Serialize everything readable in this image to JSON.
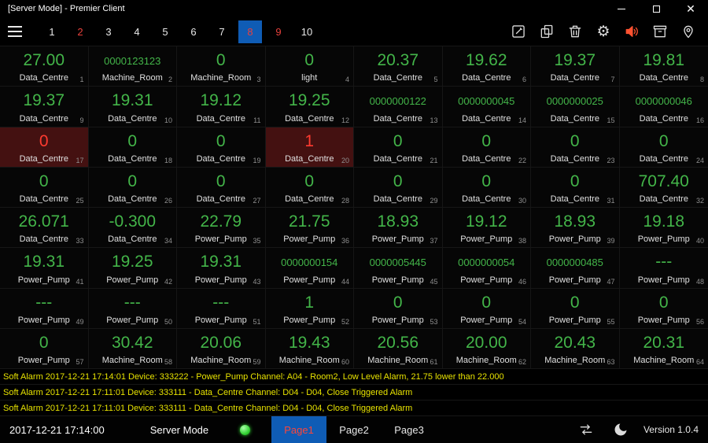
{
  "window": {
    "title": "[Server Mode] - Premier Client"
  },
  "icons": {
    "gear": "⚙",
    "map": {
      "menu": "hamburger",
      "edit": "pencil-square",
      "report": "copy-pages",
      "delete": "trash-bin",
      "settings": "gear",
      "alarm_sound": "speaker-red",
      "clear": "archive-box",
      "location": "map-pin",
      "sync": "swap-arrows",
      "theme": "crescent-moon",
      "mode": "green-dot"
    }
  },
  "colors": {
    "value_green": "#43b549",
    "alarm_red": "#ff3b30",
    "alarm_tile_bg": "#441111",
    "page_blue": "#0f5cb5",
    "alarm_text_yellow": "#e8e300",
    "status_green": "#35d435",
    "speaker_orange": "#ff5230",
    "page_alarm_red": "#e8413c",
    "active_tab_text": "#ff4538"
  },
  "toolbar": {
    "pages": [
      {
        "label": "1",
        "class": ""
      },
      {
        "label": "2",
        "class": "alarm"
      },
      {
        "label": "3",
        "class": ""
      },
      {
        "label": "4",
        "class": ""
      },
      {
        "label": "5",
        "class": ""
      },
      {
        "label": "6",
        "class": ""
      },
      {
        "label": "7",
        "class": ""
      },
      {
        "label": "8",
        "class": "selected alarm"
      },
      {
        "label": "9",
        "class": "alarm"
      },
      {
        "label": "10",
        "class": ""
      }
    ]
  },
  "grid": {
    "tiles": [
      {
        "value": "27.00",
        "label": "Data_Centre",
        "idx": "1",
        "class": ""
      },
      {
        "value": "0000123123",
        "label": "Machine_Room",
        "idx": "2",
        "class": ""
      },
      {
        "value": "0",
        "label": "Machine_Room",
        "idx": "3",
        "class": ""
      },
      {
        "value": "0",
        "label": "light",
        "idx": "4",
        "class": ""
      },
      {
        "value": "20.37",
        "label": "Data_Centre",
        "idx": "5",
        "class": ""
      },
      {
        "value": "19.62",
        "label": "Data_Centre",
        "idx": "6",
        "class": ""
      },
      {
        "value": "19.37",
        "label": "Data_Centre",
        "idx": "7",
        "class": ""
      },
      {
        "value": "19.81",
        "label": "Data_Centre",
        "idx": "8",
        "class": ""
      },
      {
        "value": "19.37",
        "label": "Data_Centre",
        "idx": "9",
        "class": ""
      },
      {
        "value": "19.31",
        "label": "Data_Centre",
        "idx": "10",
        "class": ""
      },
      {
        "value": "19.12",
        "label": "Data_Centre",
        "idx": "11",
        "class": ""
      },
      {
        "value": "19.25",
        "label": "Data_Centre",
        "idx": "12",
        "class": ""
      },
      {
        "value": "0000000122",
        "label": "Data_Centre",
        "idx": "13",
        "class": ""
      },
      {
        "value": "0000000045",
        "label": "Data_Centre",
        "idx": "14",
        "class": ""
      },
      {
        "value": "0000000025",
        "label": "Data_Centre",
        "idx": "15",
        "class": ""
      },
      {
        "value": "0000000046",
        "label": "Data_Centre",
        "idx": "16",
        "class": ""
      },
      {
        "value": "0",
        "label": "Data_Centre",
        "idx": "17",
        "class": "alarm"
      },
      {
        "value": "0",
        "label": "Data_Centre",
        "idx": "18",
        "class": ""
      },
      {
        "value": "0",
        "label": "Data_Centre",
        "idx": "19",
        "class": ""
      },
      {
        "value": "1",
        "label": "Data_Centre",
        "idx": "20",
        "class": "alarm"
      },
      {
        "value": "0",
        "label": "Data_Centre",
        "idx": "21",
        "class": ""
      },
      {
        "value": "0",
        "label": "Data_Centre",
        "idx": "22",
        "class": ""
      },
      {
        "value": "0",
        "label": "Data_Centre",
        "idx": "23",
        "class": ""
      },
      {
        "value": "0",
        "label": "Data_Centre",
        "idx": "24",
        "class": ""
      },
      {
        "value": "0",
        "label": "Data_Centre",
        "idx": "25",
        "class": ""
      },
      {
        "value": "0",
        "label": "Data_Centre",
        "idx": "26",
        "class": ""
      },
      {
        "value": "0",
        "label": "Data_Centre",
        "idx": "27",
        "class": ""
      },
      {
        "value": "0",
        "label": "Data_Centre",
        "idx": "28",
        "class": ""
      },
      {
        "value": "0",
        "label": "Data_Centre",
        "idx": "29",
        "class": ""
      },
      {
        "value": "0",
        "label": "Data_Centre",
        "idx": "30",
        "class": ""
      },
      {
        "value": "0",
        "label": "Data_Centre",
        "idx": "31",
        "class": ""
      },
      {
        "value": "707.40",
        "label": "Data_Centre",
        "idx": "32",
        "class": ""
      },
      {
        "value": "26.071",
        "label": "Data_Centre",
        "idx": "33",
        "class": ""
      },
      {
        "value": "-0.300",
        "label": "Data_Centre",
        "idx": "34",
        "class": ""
      },
      {
        "value": "22.79",
        "label": "Power_Pump",
        "idx": "35",
        "class": ""
      },
      {
        "value": "21.75",
        "label": "Power_Pump",
        "idx": "36",
        "class": ""
      },
      {
        "value": "18.93",
        "label": "Power_Pump",
        "idx": "37",
        "class": ""
      },
      {
        "value": "19.12",
        "label": "Power_Pump",
        "idx": "38",
        "class": ""
      },
      {
        "value": "18.93",
        "label": "Power_Pump",
        "idx": "39",
        "class": ""
      },
      {
        "value": "19.18",
        "label": "Power_Pump",
        "idx": "40",
        "class": ""
      },
      {
        "value": "19.31",
        "label": "Power_Pump",
        "idx": "41",
        "class": ""
      },
      {
        "value": "19.25",
        "label": "Power_Pump",
        "idx": "42",
        "class": ""
      },
      {
        "value": "19.31",
        "label": "Power_Pump",
        "idx": "43",
        "class": ""
      },
      {
        "value": "0000000154",
        "label": "Power_Pump",
        "idx": "44",
        "class": ""
      },
      {
        "value": "0000005445",
        "label": "Power_Pump",
        "idx": "45",
        "class": ""
      },
      {
        "value": "0000000054",
        "label": "Power_Pump",
        "idx": "46",
        "class": ""
      },
      {
        "value": "0000000485",
        "label": "Power_Pump",
        "idx": "47",
        "class": ""
      },
      {
        "value": "---",
        "label": "Power_Pump",
        "idx": "48",
        "class": ""
      },
      {
        "value": "---",
        "label": "Power_Pump",
        "idx": "49",
        "class": ""
      },
      {
        "value": "---",
        "label": "Power_Pump",
        "idx": "50",
        "class": ""
      },
      {
        "value": "---",
        "label": "Power_Pump",
        "idx": "51",
        "class": ""
      },
      {
        "value": "1",
        "label": "Power_Pump",
        "idx": "52",
        "class": ""
      },
      {
        "value": "0",
        "label": "Power_Pump",
        "idx": "53",
        "class": ""
      },
      {
        "value": "0",
        "label": "Power_Pump",
        "idx": "54",
        "class": ""
      },
      {
        "value": "0",
        "label": "Power_Pump",
        "idx": "55",
        "class": ""
      },
      {
        "value": "0",
        "label": "Power_Pump",
        "idx": "56",
        "class": ""
      },
      {
        "value": "0",
        "label": "Power_Pump",
        "idx": "57",
        "class": ""
      },
      {
        "value": "30.42",
        "label": "Machine_Room",
        "idx": "58",
        "class": ""
      },
      {
        "value": "20.06",
        "label": "Machine_Room",
        "idx": "59",
        "class": ""
      },
      {
        "value": "19.43",
        "label": "Machine_Room",
        "idx": "60",
        "class": ""
      },
      {
        "value": "20.56",
        "label": "Machine_Room",
        "idx": "61",
        "class": ""
      },
      {
        "value": "20.00",
        "label": "Machine_Room",
        "idx": "62",
        "class": ""
      },
      {
        "value": "20.43",
        "label": "Machine_Room",
        "idx": "63",
        "class": ""
      },
      {
        "value": "20.31",
        "label": "Machine_Room",
        "idx": "64",
        "class": ""
      }
    ]
  },
  "alarm_log": [
    {
      "text": "Soft Alarm 2017-12-21 17:14:01 Device: 333222 - Power_Pump Channel: A04 - Room2, Low Level Alarm, 21.75 lower than 22.000"
    },
    {
      "text": "Soft Alarm 2017-12-21 17:11:01 Device: 333111 - Data_Centre Channel: D04 - D04, Close Triggered Alarm"
    },
    {
      "text": "Soft Alarm 2017-12-21 17:11:01 Device: 333111 - Data_Centre Channel: D04 - D04, Close Triggered Alarm"
    }
  ],
  "statusbar": {
    "timestamp": "2017-12-21 17:14:00",
    "mode_label": "Server Mode",
    "tabs": [
      {
        "label": "Page1",
        "class": "active"
      },
      {
        "label": "Page2",
        "class": ""
      },
      {
        "label": "Page3",
        "class": ""
      }
    ],
    "version": "Version 1.0.4"
  }
}
